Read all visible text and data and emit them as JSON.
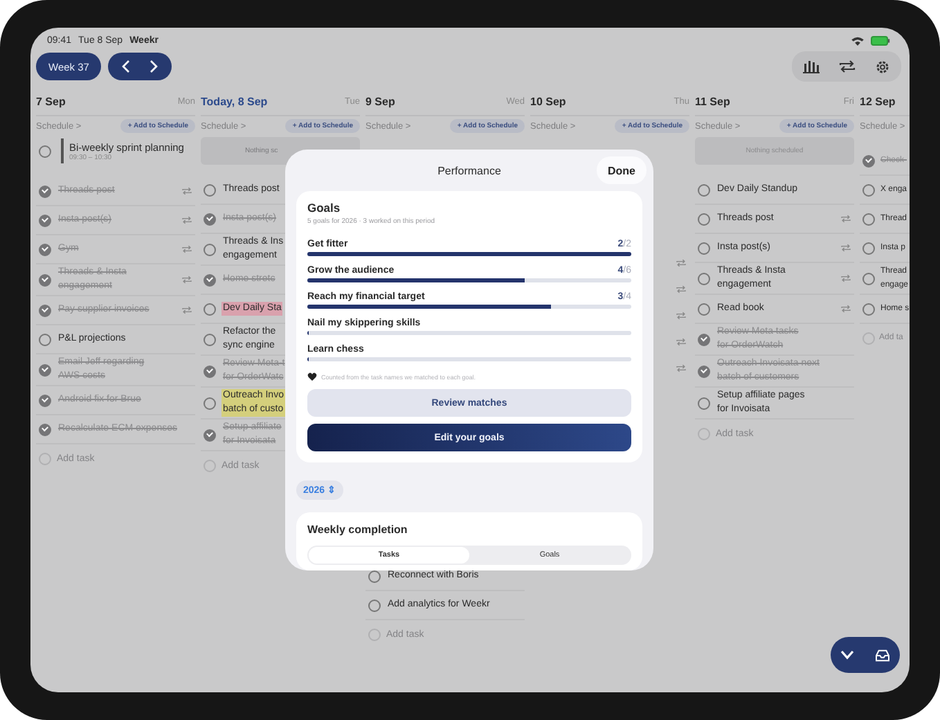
{
  "status_bar": {
    "time": "09:41",
    "date": "Tue 8 Sep",
    "app": "Weekr"
  },
  "toolbar": {
    "week": "Week 37"
  },
  "days": [
    {
      "date": "7 Sep",
      "weekday": "Mon",
      "today": false,
      "schedule": "Schedule >",
      "add_button": "+ Add to Schedule",
      "event": {
        "title": "Bi-weekly sprint planning",
        "time": "09:30 – 10:30"
      },
      "tasks": [
        {
          "title": "Threads post",
          "done": true,
          "repeating": true
        },
        {
          "title": "Insta post(s)",
          "done": true,
          "repeating": true
        },
        {
          "title": "Gym",
          "done": true,
          "repeating": true
        },
        {
          "title": "Threads & Insta\nengagement",
          "done": true,
          "repeating": true
        },
        {
          "title": "Pay supplier invoices",
          "done": true,
          "repeating": true
        },
        {
          "title": "P&L projections",
          "done": false,
          "repeating": false
        },
        {
          "title": "Email Jeff regarding\nAWS costs",
          "done": true,
          "repeating": false
        },
        {
          "title": "Android fix for Brue",
          "done": true,
          "repeating": false
        },
        {
          "title": "Recalculate ECM expenses",
          "done": true,
          "repeating": false
        }
      ],
      "add_task": "Add task"
    },
    {
      "date": "Today, 8 Sep",
      "weekday": "Tue",
      "today": true,
      "schedule": "Schedule >",
      "add_button": "+ Add to Schedule",
      "empty_note": "Nothing sc",
      "tasks": [
        {
          "title": "Threads post",
          "done": false,
          "repeating": false
        },
        {
          "title": "Insta post(s)",
          "done": true,
          "repeating": false
        },
        {
          "title": "Threads & Ins\nengagement",
          "done": false,
          "repeating": false
        },
        {
          "title": "Home stretc",
          "done": true,
          "repeating": false
        },
        {
          "title": "Dev Daily Sta",
          "done": false,
          "repeating": false,
          "color": "#d9a1ad"
        },
        {
          "title": "Refactor the\nsync engine",
          "done": false,
          "repeating": false
        },
        {
          "title": "Review Meta-t\nfor OrderWatc",
          "done": true,
          "repeating": false
        },
        {
          "title": "Outreach Invo\nbatch of custo",
          "done": false,
          "repeating": false,
          "color": "#d4cf7c"
        },
        {
          "title": "Setup affiliate\nfor Invoisata",
          "done": true,
          "repeating": false
        }
      ],
      "add_task": "Add task"
    },
    {
      "date": "9 Sep",
      "weekday": "Wed",
      "today": false,
      "schedule": "Schedule >",
      "add_button": "+ Add to Schedule",
      "tasks": [
        {
          "title": "Reconnect with Boris",
          "done": false,
          "repeating": false
        },
        {
          "title": "Add analytics for Weekr",
          "done": false,
          "repeating": false
        }
      ],
      "add_task": "Add task"
    },
    {
      "date": "10 Sep",
      "weekday": "Thu",
      "today": false,
      "schedule": "Schedule >",
      "add_button": "+ Add to Schedule",
      "tasks": [
        {
          "repeating": true
        },
        {
          "repeating": true
        },
        {
          "repeating": true
        },
        {
          "repeating": true
        },
        {
          "repeating": true
        }
      ]
    },
    {
      "date": "11 Sep",
      "weekday": "Fri",
      "today": false,
      "schedule": "Schedule >",
      "add_button": "+ Add to Schedule",
      "empty_note": "Nothing scheduled",
      "tasks": [
        {
          "title": "Dev Daily Standup",
          "done": false,
          "repeating": false
        },
        {
          "title": "Threads post",
          "done": false,
          "repeating": true
        },
        {
          "title": "Insta post(s)",
          "done": false,
          "repeating": true
        },
        {
          "title": "Threads & Insta\nengagement",
          "done": false,
          "repeating": true
        },
        {
          "title": "Read book",
          "done": false,
          "repeating": true
        },
        {
          "title": "Review Meta tasks\nfor OrderWatch",
          "done": true,
          "repeating": false
        },
        {
          "title": "Outreach Invoisata next\nbatch of customers",
          "done": true,
          "repeating": false
        },
        {
          "title": "Setup affiliate pages\nfor Invoisata",
          "done": false,
          "repeating": false
        }
      ],
      "add_task": "Add task"
    },
    {
      "date": "12 Sep",
      "today": false,
      "schedule": "Schedule >",
      "tasks": [
        {
          "title": "Check-",
          "done": true,
          "repeating": false
        },
        {
          "title": "X enga",
          "done": false,
          "repeating": false
        },
        {
          "title": "Thread",
          "done": false,
          "repeating": false
        },
        {
          "title": "Insta p",
          "done": false,
          "repeating": false
        },
        {
          "title": "Thread\nengage",
          "done": false,
          "repeating": false
        },
        {
          "title": "Home s",
          "done": false,
          "repeating": false
        }
      ],
      "add_task": "Add ta"
    }
  ],
  "performance": {
    "title": "Performance",
    "done_button": "Done",
    "goals": {
      "title": "Goals",
      "subtitle": "5 goals for 2026 · 3 worked on this period",
      "items": [
        {
          "name": "Get fitter",
          "done": "2",
          "total": "/2",
          "level": 1
        },
        {
          "name": "Grow the audience",
          "done": "4",
          "total": "/6",
          "level": 0.67
        },
        {
          "name": "Reach my financial target",
          "done": "3",
          "total": "/4",
          "level": 0.75
        },
        {
          "name": "Nail my skippering skills",
          "level": 0
        },
        {
          "name": "Learn chess",
          "level": 0
        }
      ],
      "note": "Counted from the task names we matched to each goal.",
      "review_button": "Review matches",
      "edit_button": "Edit your goals"
    },
    "year": "2026 ⇕",
    "weekly": {
      "title": "Weekly completion",
      "tabs": [
        {
          "label": "Tasks",
          "selected": true
        },
        {
          "label": "Goals",
          "selected": false
        }
      ]
    }
  }
}
